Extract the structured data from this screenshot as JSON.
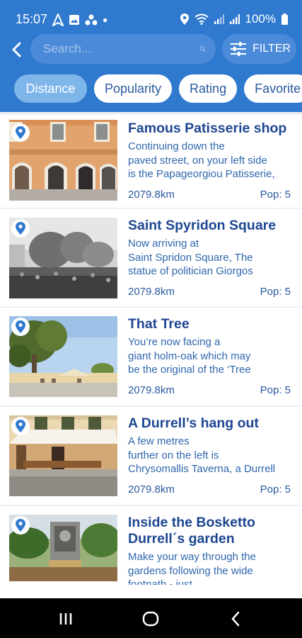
{
  "status": {
    "time": "15:07",
    "battery": "100%"
  },
  "search": {
    "placeholder": "Search..."
  },
  "filter": {
    "label": "FILTER"
  },
  "tabs": [
    {
      "label": "Distance",
      "active": true
    },
    {
      "label": "Popularity",
      "active": false
    },
    {
      "label": "Rating",
      "active": false
    },
    {
      "label": "Favorite",
      "active": false
    }
  ],
  "places": [
    {
      "title": "Famous Patisserie shop",
      "desc_lines": [
        "Continuing down the",
        "paved street, on your left side",
        "is the Papageorgiou Patisserie,"
      ],
      "distance": "2079.8km",
      "pop": "Pop: 5"
    },
    {
      "title": "Saint Spyridon Square",
      "desc_lines": [
        "Now arriving at",
        "Saint Spridon Square, The",
        "statue of politician Giorgos"
      ],
      "distance": "2079.8km",
      "pop": "Pop: 5"
    },
    {
      "title": "That Tree",
      "desc_lines": [
        "You’re now facing a",
        "giant holm-oak which may",
        "be the original of the ‘Tree"
      ],
      "distance": "2079.8km",
      "pop": "Pop: 5"
    },
    {
      "title": "A Durrell’s hang out",
      "desc_lines": [
        "A few metres",
        "further on the left is",
        "Chrysomallis Taverna, a Durrell"
      ],
      "distance": "2079.8km",
      "pop": "Pop: 5"
    },
    {
      "title_lines": [
        "Inside the Bosketto",
        "Durrell´s garden"
      ],
      "desc_lines": [
        "Make your way through the",
        "gardens following the wide",
        "footpath - just"
      ]
    }
  ],
  "colors": {
    "header": "#2f79cf",
    "accent": "#7eb6ea",
    "title": "#1d4691"
  }
}
